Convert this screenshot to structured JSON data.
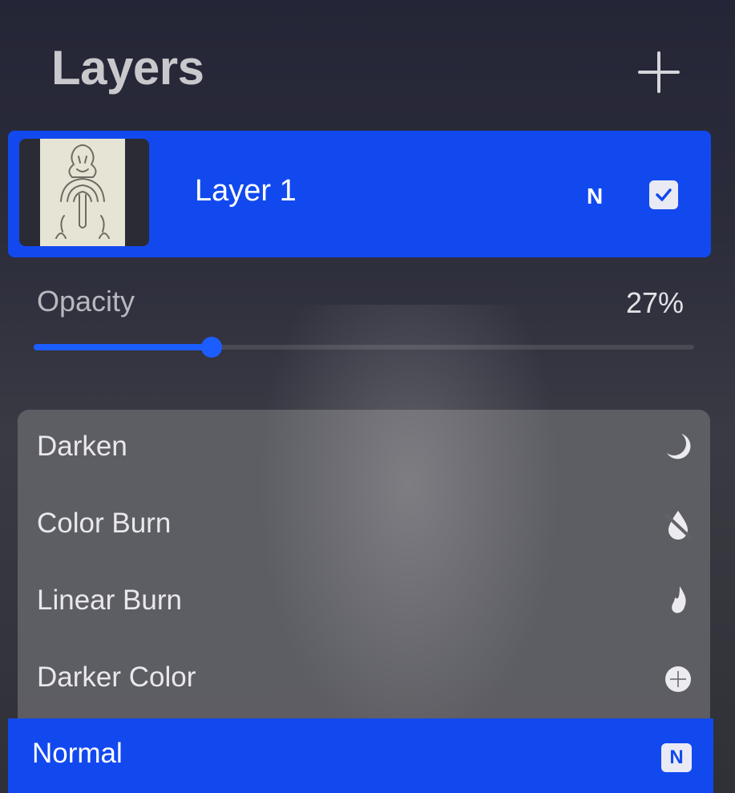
{
  "header": {
    "title": "Layers",
    "add_icon": "plus-icon"
  },
  "layer": {
    "name": "Layer 1",
    "blend_mode_letter": "N",
    "visible": true,
    "thumbnail_icon": "line-drawing-thumbnail"
  },
  "opacity": {
    "label": "Opacity",
    "value_text": "27%",
    "fraction": 0.27
  },
  "blend_modes": [
    {
      "label": "Darken",
      "icon": "moon-icon"
    },
    {
      "label": "Color Burn",
      "icon": "burn-icon"
    },
    {
      "label": "Linear Burn",
      "icon": "flame-icon"
    },
    {
      "label": "Darker Color",
      "icon": "darker-color-icon"
    }
  ],
  "selected_mode": {
    "label": "Normal",
    "badge": "N"
  },
  "colors": {
    "accent": "#1249ef",
    "panel": "#2c2d3b",
    "list": "#626268"
  }
}
